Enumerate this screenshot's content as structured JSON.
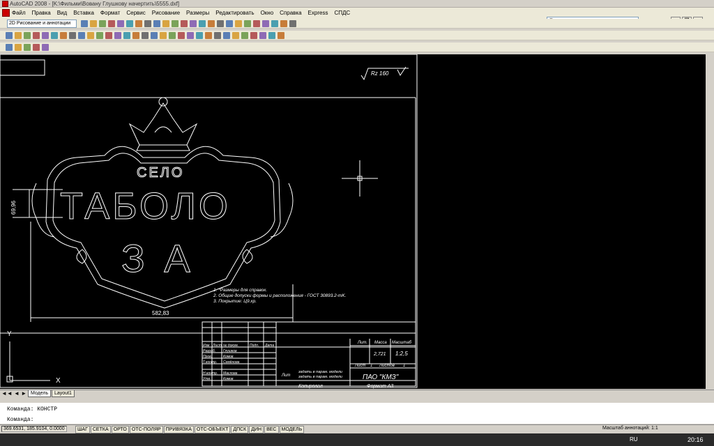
{
  "window": {
    "title": "AutoCAD 2008 - [K:\\Фильми\\Вовану Глушкову начертить\\5555.dxf]"
  },
  "menu": {
    "items": [
      "Файл",
      "Правка",
      "Вид",
      "Вставка",
      "Формат",
      "Сервис",
      "Рисование",
      "Размеры",
      "Редактировать",
      "Окно",
      "Справка",
      "Express",
      "СПДС"
    ]
  },
  "help": {
    "placeholder": "Введите вопрос для справки"
  },
  "toolbar": {
    "workspace": "2D Рисование и аннотации"
  },
  "drawing": {
    "roughness": "Rz 160",
    "village_word": "СЕЛО",
    "main_word": "ТАБОЛО",
    "letters": "З А",
    "dim_height": "69,96",
    "dim_width": "582,83",
    "notes": [
      "1. *Размеры для справок.",
      "2. Общие допуски формы и расположения - ГОСТ 30893.2-mK.",
      "3. Покрытие: Ц9.хр."
    ],
    "title_block": {
      "col_lit": "Лит.",
      "col_mass": "Масса",
      "col_scale": "Масштаб",
      "mass": "2,721",
      "scale": "1:2,5",
      "sheet": "Лист",
      "sheet_num": "1",
      "sheets": "Листов",
      "sheets_num": "1",
      "company": "ПАО \"КМЗ\"",
      "rows": [
        {
          "role": "Изм",
          "c1": "Лист",
          "c2": "№ докум.",
          "c3": "Подп.",
          "c4": "Дата"
        },
        {
          "role": "Разраб.",
          "name": "Глушков"
        },
        {
          "role": "Пров.",
          "name": "Комов"
        },
        {
          "role": "Т.контр.",
          "name": "Семёнова"
        },
        {
          "role": "Н.контр.",
          "name": "Маслова"
        },
        {
          "role": "Утв.",
          "name": "Комов"
        }
      ],
      "material_line1": "задать в парам. модели",
      "material_line2": "задать в парам. модели",
      "lit_label": "Лит",
      "copied": "Копировал",
      "format": "Формат А3"
    }
  },
  "tabs": [
    "Модель",
    "Layout1"
  ],
  "command": {
    "line1": "Команда: КОНСТР",
    "line2": "Команда:"
  },
  "status": {
    "coords": "369.6531, 185.9104, 0.0000",
    "buttons": [
      "ШАГ",
      "СЕТКА",
      "ОРТО",
      "ОТС-ПОЛЯР",
      "ПРИВЯЗКА",
      "ОТС-ОБЪЕКТ",
      "ДПСК",
      "ДИН",
      "ВЕС",
      "МОДЕЛЬ"
    ],
    "annotation_scale_label": "Масштаб аннотаций:",
    "annotation_scale": "1:1"
  },
  "taskbar": {
    "lang": "RU",
    "clock": "20:16"
  },
  "colors": {
    "canvas": "#000000",
    "lines": "#ffffff",
    "chrome": "#d4d0c8"
  }
}
